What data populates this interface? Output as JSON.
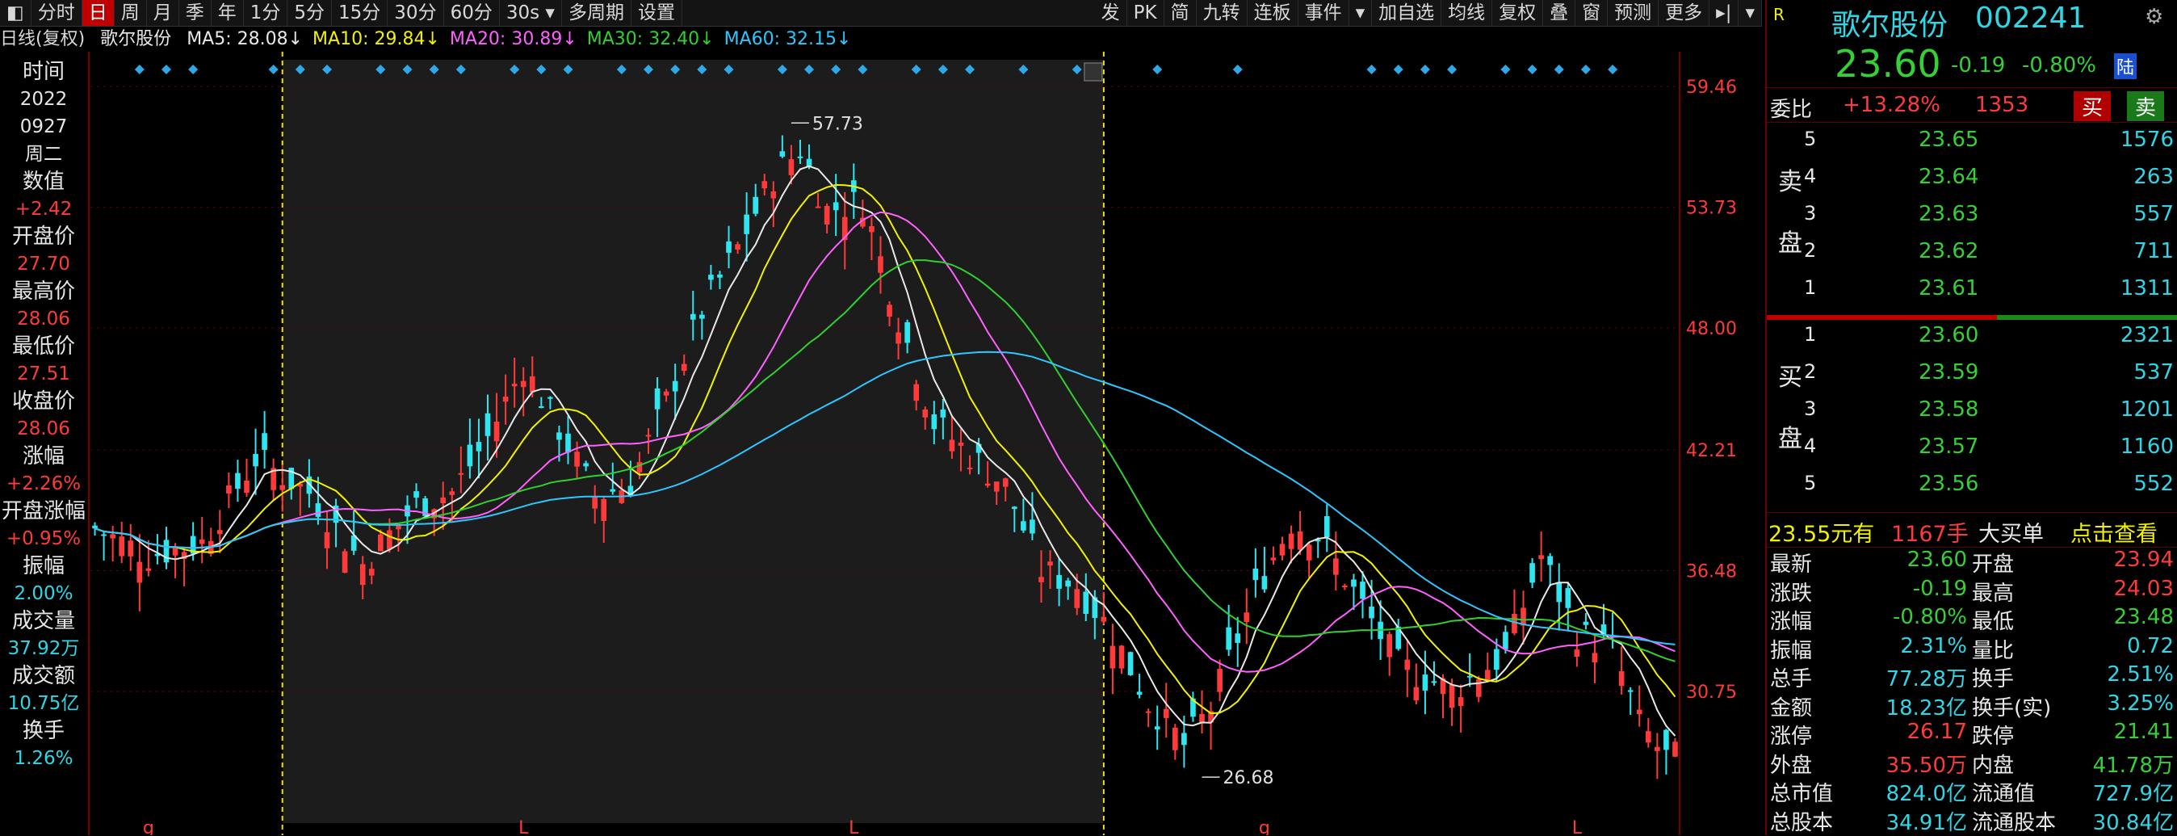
{
  "toolbar": {
    "items": [
      "分时",
      "日",
      "周",
      "月",
      "季",
      "年",
      "1分",
      "5分",
      "15分",
      "30分",
      "60分",
      "30s ▾",
      "多周期",
      "设置"
    ],
    "active_index": 1,
    "right_items": [
      "发",
      "PK",
      "简",
      "九转",
      "连板",
      "事件",
      "▾",
      "加自选",
      "均线",
      "复权",
      "叠",
      "窗",
      "预测",
      "更多",
      "▸|",
      "▾"
    ]
  },
  "ma_legend": {
    "label": "日线(复权)",
    "stock": "歌尔股份",
    "items": [
      {
        "text": "MA5: 28.08↓",
        "color": "#e8e8e8"
      },
      {
        "text": "MA10: 29.84↓",
        "color": "#f2f200"
      },
      {
        "text": "MA20: 30.89↓",
        "color": "#ff60ff"
      },
      {
        "text": "MA30: 32.40↓",
        "color": "#30d030"
      },
      {
        "text": "MA60: 32.15↓",
        "color": "#2fc6ff"
      }
    ]
  },
  "left_info": [
    {
      "label": "时间",
      "value": "2022",
      "color": "#e6e6e6"
    },
    {
      "label": "",
      "value": "0927",
      "color": "#e6e6e6"
    },
    {
      "label": "",
      "value": "周二",
      "color": "#e6e6e6"
    },
    {
      "label": "数值",
      "value": "+2.42",
      "color": "#ff3a3a"
    },
    {
      "label": "开盘价",
      "value": "27.70",
      "color": "#ff3a3a"
    },
    {
      "label": "最高价",
      "value": "28.06",
      "color": "#ff3a3a"
    },
    {
      "label": "最低价",
      "value": "27.51",
      "color": "#ff3a3a"
    },
    {
      "label": "收盘价",
      "value": "28.06",
      "color": "#ff3a3a"
    },
    {
      "label": "涨幅",
      "value": "+2.26%",
      "color": "#ff3a3a"
    },
    {
      "label": "开盘涨幅",
      "value": "+0.95%",
      "color": "#ff3a3a"
    },
    {
      "label": "振幅",
      "value": "2.00%",
      "color": "#2fd6e6"
    },
    {
      "label": "成交量",
      "value": "37.92万",
      "color": "#2fd6e6"
    },
    {
      "label": "成交额",
      "value": "10.75亿",
      "color": "#2fd6e6"
    },
    {
      "label": "换手",
      "value": "1.26%",
      "color": "#2fd6e6"
    }
  ],
  "chart_data": {
    "type": "candlestick",
    "ylim": [
      24.5,
      60.5
    ],
    "yticks": [
      59.46,
      53.73,
      48.0,
      42.21,
      36.48,
      30.75
    ],
    "ytick_labels": [
      "59.46",
      "53.73",
      "48.00",
      "42.21",
      "36.48",
      "30.75"
    ],
    "annotations": [
      {
        "text": "57.73",
        "index": 78,
        "value": 57.73
      },
      {
        "text": "26.68",
        "index": 124,
        "value": 26.68
      }
    ],
    "bottom_markers": [
      {
        "text": "g",
        "index": 6
      },
      {
        "text": "L",
        "index": 48
      },
      {
        "text": "L",
        "index": 85
      },
      {
        "text": "g",
        "index": 131
      },
      {
        "text": "L",
        "index": 166
      }
    ],
    "highlight_range": [
      21,
      113
    ],
    "colors": {
      "up": "#ff3a3a",
      "down": "#2fe6f0",
      "ma5": "#e8e8e8",
      "ma10": "#f2f200",
      "ma20": "#ff60ff",
      "ma30": "#30d030",
      "ma60": "#2fc6ff"
    },
    "close_keypoints": [
      [
        0,
        38.5
      ],
      [
        6,
        37.2
      ],
      [
        12,
        37.8
      ],
      [
        18,
        41.8
      ],
      [
        24,
        40.2
      ],
      [
        30,
        36.8
      ],
      [
        36,
        39.6
      ],
      [
        40,
        40.2
      ],
      [
        44,
        42.8
      ],
      [
        48,
        46.2
      ],
      [
        52,
        43.2
      ],
      [
        56,
        40.0
      ],
      [
        60,
        40.6
      ],
      [
        64,
        44.5
      ],
      [
        68,
        48.8
      ],
      [
        72,
        51.8
      ],
      [
        76,
        55.2
      ],
      [
        79,
        56.5
      ],
      [
        82,
        53.6
      ],
      [
        86,
        54.0
      ],
      [
        90,
        48.5
      ],
      [
        94,
        43.5
      ],
      [
        98,
        42.0
      ],
      [
        102,
        40.5
      ],
      [
        106,
        36.5
      ],
      [
        110,
        35.8
      ],
      [
        114,
        33.5
      ],
      [
        118,
        30.2
      ],
      [
        122,
        28.2
      ],
      [
        125,
        30.0
      ],
      [
        130,
        35.5
      ],
      [
        134,
        38.8
      ],
      [
        137,
        38.2
      ],
      [
        141,
        35.5
      ],
      [
        146,
        32.0
      ],
      [
        152,
        30.8
      ],
      [
        158,
        32.5
      ],
      [
        162,
        37.2
      ],
      [
        166,
        33.5
      ],
      [
        170,
        32.8
      ],
      [
        173,
        29.2
      ],
      [
        176,
        27.6
      ]
    ]
  },
  "right_panel": {
    "badge": "R",
    "title": "歌尔股份",
    "code": "002241",
    "price": "23.60",
    "change": "-0.19",
    "change_pct": "-0.80%",
    "market_tag": "陆",
    "weibi_label": "委比",
    "weibi_value": "+13.28%",
    "weibi_count": "1353",
    "buy_btn": "买",
    "sell_btn": "卖",
    "sell_label": "卖盘",
    "buy_label": "买盘",
    "asks": [
      {
        "level": "5",
        "price": "23.65",
        "vol": "1576"
      },
      {
        "level": "4",
        "price": "23.64",
        "vol": "263"
      },
      {
        "level": "3",
        "price": "23.63",
        "vol": "557"
      },
      {
        "level": "2",
        "price": "23.62",
        "vol": "711"
      },
      {
        "level": "1",
        "price": "23.61",
        "vol": "1311"
      }
    ],
    "bids": [
      {
        "level": "1",
        "price": "23.60",
        "vol": "2321"
      },
      {
        "level": "2",
        "price": "23.59",
        "vol": "537"
      },
      {
        "level": "3",
        "price": "23.58",
        "vol": "1201"
      },
      {
        "level": "4",
        "price": "23.57",
        "vol": "1160"
      },
      {
        "level": "5",
        "price": "23.56",
        "vol": "552"
      }
    ],
    "big_order": {
      "price": "23.55元有",
      "qty": "1167手",
      "label": "大买单",
      "link": "点击查看"
    },
    "stats": [
      {
        "l1": "最新",
        "v1": "23.60",
        "c1": "#35d035",
        "l2": "开盘",
        "v2": "23.94",
        "c2": "#ff3a3a"
      },
      {
        "l1": "涨跌",
        "v1": "-0.19",
        "c1": "#35d035",
        "l2": "最高",
        "v2": "24.03",
        "c2": "#ff3a3a"
      },
      {
        "l1": "涨幅",
        "v1": "-0.80%",
        "c1": "#35d035",
        "l2": "最低",
        "v2": "23.48",
        "c2": "#35d035"
      },
      {
        "l1": "振幅",
        "v1": "2.31%",
        "c1": "#2fd6e6",
        "l2": "量比",
        "v2": "0.72",
        "c2": "#2fd6e6"
      },
      {
        "l1": "总手",
        "v1": "77.28万",
        "c1": "#2fd6e6",
        "l2": "换手",
        "v2": "2.51%",
        "c2": "#2fd6e6"
      },
      {
        "l1": "金额",
        "v1": "18.23亿",
        "c1": "#2fd6e6",
        "l2": "换手(实)",
        "v2": "3.25%",
        "c2": "#2fd6e6"
      },
      {
        "l1": "涨停",
        "v1": "26.17",
        "c1": "#ff3a3a",
        "l2": "跌停",
        "v2": "21.41",
        "c2": "#35d035"
      },
      {
        "l1": "外盘",
        "v1": "35.50万",
        "c1": "#ff3a3a",
        "l2": "内盘",
        "v2": "41.78万",
        "c2": "#35d035"
      },
      {
        "l1": "总市值",
        "v1": "824.0亿",
        "c1": "#2fd6e6",
        "l2": "流通值",
        "v2": "727.9亿",
        "c2": "#2fd6e6"
      },
      {
        "l1": "总股本",
        "v1": "34.91亿",
        "c1": "#2fd6e6",
        "l2": "流通股本",
        "v2": "30.84亿",
        "c2": "#2fd6e6"
      }
    ]
  }
}
